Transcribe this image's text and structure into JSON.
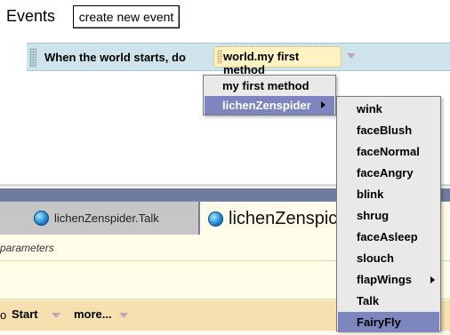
{
  "events": {
    "title": "Events",
    "create_button": "create new event",
    "event_label": "When the world starts, do",
    "method_value": "world.my first method"
  },
  "method_menu": {
    "items": [
      {
        "label": "my first method",
        "selected": false,
        "has_submenu": false
      },
      {
        "label": "lichenZenspider",
        "selected": true,
        "has_submenu": true
      }
    ]
  },
  "submenu": {
    "items": [
      {
        "label": "wink"
      },
      {
        "label": "faceBlush"
      },
      {
        "label": "faceNormal"
      },
      {
        "label": "faceAngry"
      },
      {
        "label": "blink"
      },
      {
        "label": "shrug"
      },
      {
        "label": "faceAsleep"
      },
      {
        "label": "slouch"
      },
      {
        "label": "flapWings",
        "has_submenu": true
      },
      {
        "label": "Talk"
      },
      {
        "label": "FairyFly",
        "selected": true
      }
    ]
  },
  "tabs": [
    {
      "label": "lichenZenspider.Talk",
      "active": false,
      "icon": "object-ball-icon"
    },
    {
      "label": "lichenZenspic",
      "active": true,
      "icon": "object-ball-icon"
    }
  ],
  "editor": {
    "params_label": "parameters",
    "cmd_prefix": "o",
    "start_label": "Start",
    "more_label": "more..."
  },
  "colors": {
    "event_row": "#cfe4ea",
    "method_chip": "#fff3c4",
    "menu_bg": "#e9e9e9",
    "menu_selected": "#7e86c0",
    "tab_bar": "#7b87a8",
    "editor_bg": "#fffde9",
    "cmd_row": "#f7e0b0"
  }
}
